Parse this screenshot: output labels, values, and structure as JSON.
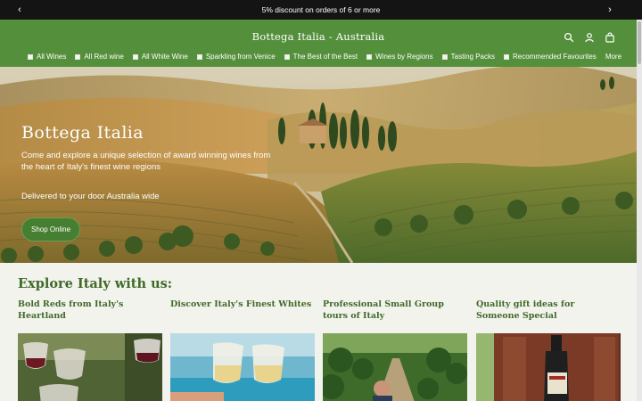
{
  "announcement": {
    "text": "5% discount on orders of 6 or more",
    "prev_icon": "chevron-left-icon",
    "next_icon": "chevron-right-icon"
  },
  "header": {
    "logo": "Bottega Italia - Australia",
    "icons": [
      "search-icon",
      "account-icon",
      "cart-icon"
    ],
    "background": "#548f3b"
  },
  "nav": {
    "items": [
      {
        "label": "All Wines"
      },
      {
        "label": "All Red wine"
      },
      {
        "label": "All White Wine"
      },
      {
        "label": "Sparkling from Venice"
      },
      {
        "label": "The Best of the Best"
      },
      {
        "label": "Wines by Regions"
      },
      {
        "label": "Tasting Packs"
      },
      {
        "label": "Recommended Favourites"
      }
    ],
    "more": "More"
  },
  "hero": {
    "title": "Bottega Italia",
    "subtitle": "Come and explore a unique selection of award winning wines from the heart of Italy's finest wine regions",
    "delivery": "Delivered to your door Australia wide",
    "button": "Shop Online"
  },
  "explore": {
    "heading": "Explore Italy with us:",
    "cards": [
      {
        "title": "Bold Reds from Italy's Heartland"
      },
      {
        "title": "Discover Italy's Finest Whites"
      },
      {
        "title": "Professional Small Group tours of Italy"
      },
      {
        "title": "Quality gift ideas for Someone Special"
      }
    ]
  },
  "colors": {
    "accent": "#3f6a28",
    "announcement_bg": "#141414",
    "page_bg": "#f3f3ee"
  }
}
